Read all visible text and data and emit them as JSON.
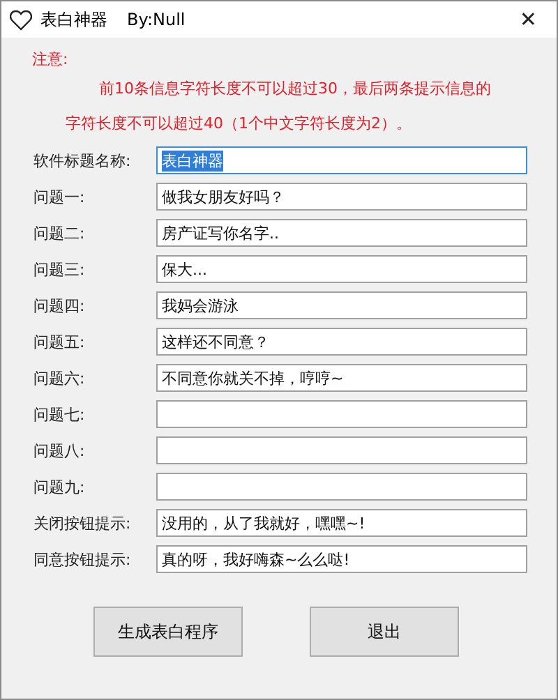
{
  "window": {
    "title": "表白神器",
    "author": "By:Null",
    "close": "✕"
  },
  "notice": {
    "heading": "注意:",
    "line_1": "前10条信息字符长度不可以超过30，最后两条提示信息的",
    "line_2": "字符长度不可以超过40（1个中文字符长度为2）。"
  },
  "fields": [
    {
      "label": "软件标题名称:",
      "value": "表白神器",
      "highlighted": true
    },
    {
      "label": "问题一:",
      "value": "做我女朋友好吗？",
      "highlighted": false
    },
    {
      "label": "问题二:",
      "value": "房产证写你名字..",
      "highlighted": false
    },
    {
      "label": "问题三:",
      "value": "保大...",
      "highlighted": false
    },
    {
      "label": "问题四:",
      "value": "我妈会游泳",
      "highlighted": false
    },
    {
      "label": "问题五:",
      "value": "这样还不同意？",
      "highlighted": false
    },
    {
      "label": "问题六:",
      "value": "不同意你就关不掉，哼哼~",
      "highlighted": false
    },
    {
      "label": "问题七:",
      "highlighted": false
    },
    {
      "label": "问题八:",
      "highlighted": false
    },
    {
      "label": "问题九:",
      "highlighted": false
    },
    {
      "label": "关闭按钮提示:",
      "value": "没用的，从了我就好，嘿嘿~!",
      "highlighted": false
    },
    {
      "label": "同意按钮提示:",
      "value": "真的呀，我好嗨森~么么哒!",
      "highlighted": false
    }
  ],
  "buttons": [
    "生成表白程序",
    "退出"
  ]
}
